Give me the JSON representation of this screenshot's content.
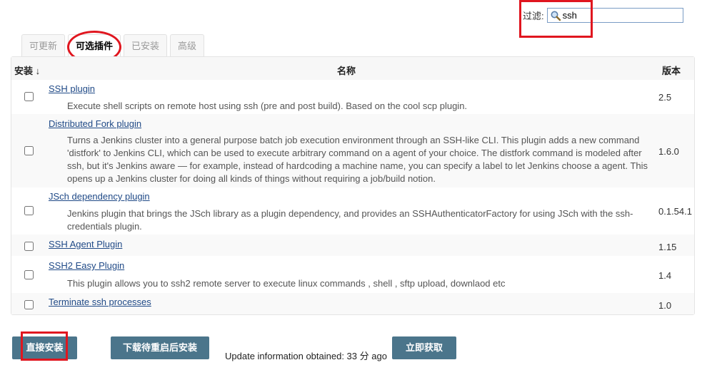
{
  "filter": {
    "label": "过滤:",
    "value": "ssh"
  },
  "tabs": [
    {
      "label": "可更新",
      "active": false
    },
    {
      "label": "可选插件",
      "active": true
    },
    {
      "label": "已安装",
      "active": false
    },
    {
      "label": "高级",
      "active": false
    }
  ],
  "table": {
    "headers": {
      "install": "安装 ↓",
      "name": "名称",
      "version": "版本"
    },
    "rows": [
      {
        "name": "SSH plugin",
        "excerpt": "Execute shell scripts on remote host using ssh (pre and post build). Based on the cool scp plugin.",
        "version": "2.5"
      },
      {
        "name": "Distributed Fork plugin",
        "excerpt": "Turns a Jenkins cluster into a general purpose batch job execution environment through an SSH-like CLI. This plugin adds a new command 'distfork' to Jenkins CLI, which can be used to execute arbitrary command on a agent of your choice. The distfork command is modeled after ssh, but it's Jenkins aware — for example, instead of hardcoding a machine name, you can specify a label to let Jenkins choose a agent. This opens up a Jenkins cluster for doing all kinds of things without requiring a job/build notion.",
        "version": "1.6.0"
      },
      {
        "name": "JSch dependency plugin",
        "excerpt": "Jenkins plugin that brings the JSch library as a plugin dependency, and provides an SSHAuthenticatorFactory for using JSch with the ssh-credentials plugin.",
        "version": "0.1.54.1"
      },
      {
        "name": "SSH Agent Plugin",
        "excerpt": "",
        "version": "1.15"
      },
      {
        "name": "SSH2 Easy Plugin",
        "excerpt": "This plugin allows you to ssh2 remote server to execute linux commands , shell , sftp upload, downlaod etc",
        "version": "1.4"
      },
      {
        "name": "Terminate ssh processes",
        "excerpt": "",
        "version": "1.0"
      }
    ]
  },
  "buttons": {
    "install_now": "直接安装",
    "download_restart": "下载待重启后安装",
    "check_now": "立即获取"
  },
  "update_info": "Update information obtained: 33 分 ago",
  "icons": {
    "filter": "search-icon"
  },
  "colors": {
    "highlight": "#e0161f",
    "button": "#4b758b",
    "link": "#204a87"
  }
}
